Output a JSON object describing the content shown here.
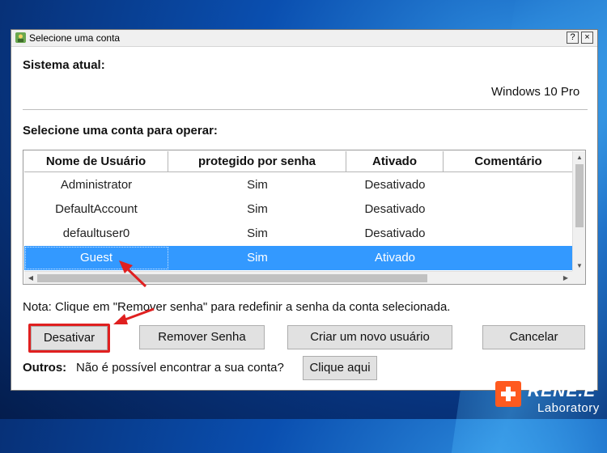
{
  "window": {
    "title": "Selecione uma conta",
    "help_btn": "?",
    "close_btn": "×"
  },
  "system": {
    "label": "Sistema atual:",
    "value": "Windows 10 Pro"
  },
  "accounts": {
    "label": "Selecione uma conta para operar:",
    "columns": [
      "Nome de Usuário",
      "protegido por senha",
      "Ativado",
      "Comentário"
    ],
    "rows": [
      {
        "name": "Administrator",
        "protected": "Sim",
        "enabled": "Desativado",
        "comment": ""
      },
      {
        "name": "DefaultAccount",
        "protected": "Sim",
        "enabled": "Desativado",
        "comment": ""
      },
      {
        "name": "defaultuser0",
        "protected": "Sim",
        "enabled": "Desativado",
        "comment": ""
      },
      {
        "name": "Guest",
        "protected": "Sim",
        "enabled": "Ativado",
        "comment": ""
      }
    ],
    "selected_row": "Guest"
  },
  "note": "Nota: Clique em \"Remover senha\" para redefinir a senha da conta selecionada.",
  "buttons": {
    "deactivate": "Desativar",
    "remove_password": "Remover Senha",
    "create_user": "Criar um novo usuário",
    "cancel": "Cancelar"
  },
  "others": {
    "label": "Outros:",
    "text": "Não é possível encontrar a sua conta?",
    "link": "Clique aqui"
  },
  "watermark": {
    "name": "RENE.E",
    "sub": "Laboratory"
  },
  "colors": {
    "selection": "#3399ff",
    "annotation": "#e02020",
    "logo": "#ff5a1f"
  }
}
